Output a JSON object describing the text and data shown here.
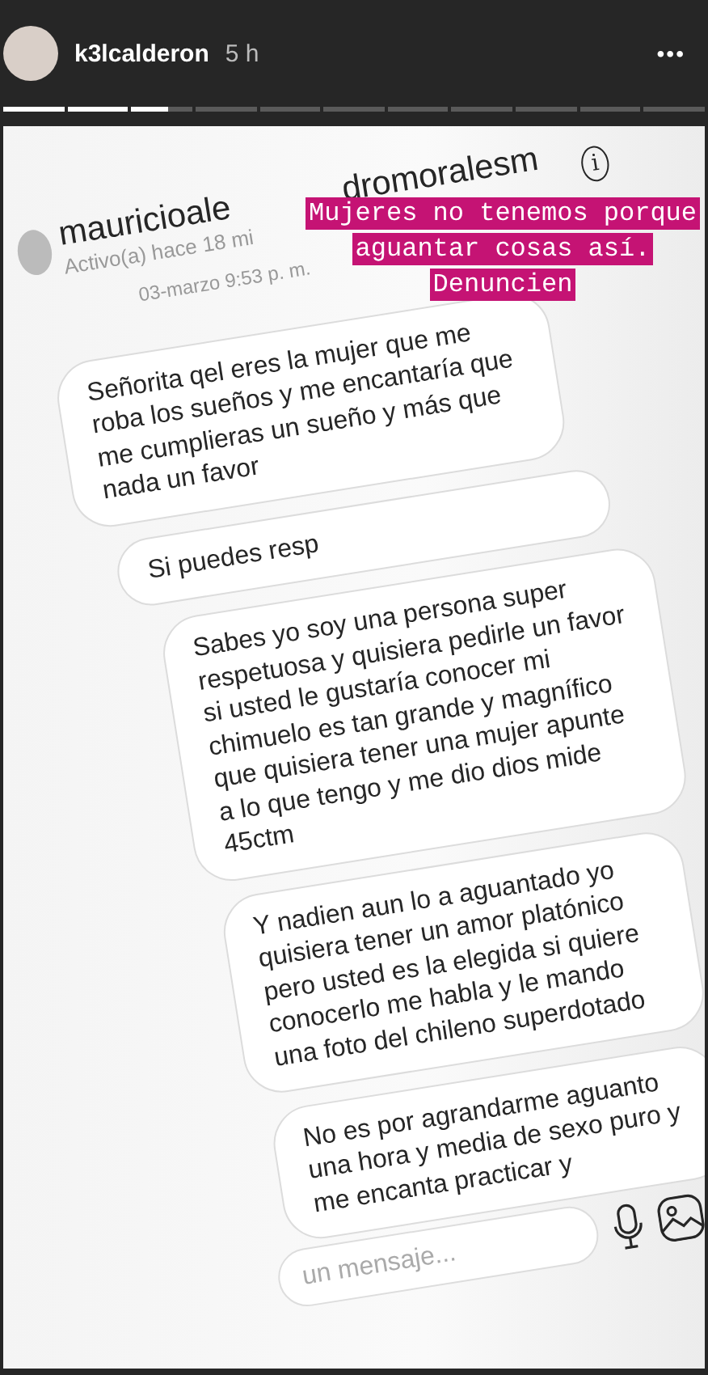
{
  "story_header": {
    "username": "k3lcalderon",
    "time": "5 h",
    "menu": "•••"
  },
  "progress_segments": [
    {
      "kind": "viewed"
    },
    {
      "kind": "viewed"
    },
    {
      "kind": "current",
      "level": 0.6
    },
    {
      "kind": "upcoming"
    },
    {
      "kind": "upcoming"
    },
    {
      "kind": "upcoming"
    },
    {
      "kind": "upcoming"
    },
    {
      "kind": "upcoming"
    },
    {
      "kind": "upcoming"
    },
    {
      "kind": "upcoming"
    },
    {
      "kind": "upcoming"
    }
  ],
  "caption_lines": [
    "Mujeres no tenemos porque",
    "aguantar cosas así.",
    "Denuncien"
  ],
  "chat": {
    "username_start": "mauricioale",
    "username_end": "dromoralesm",
    "status": "Activo(a) hace 18 mi",
    "info": "i",
    "date": "03-marzo 9:53 p. m.",
    "messages": [
      "Señorita qel eres la mujer que me roba los sueños y me encantaría que me cumplieras un sueño y más que nada un favor",
      "Si puedes resp",
      "Sabes yo soy una persona super respetuosa y quisiera pedirle un favor si usted le gustaría conocer mi chimuelo es tan grande y magnífico que quisiera tener una mujer apunte a lo que tengo y me dio dios mide 45ctm",
      "Y nadien aun lo a aguantado  yo quisiera tener un amor platónico pero usted es la elegida si quiere conocerlo me habla y le mando una foto del chileno superdotado",
      "No es por agrandarme aguanto una hora y media de sexo puro y me encanta practicar y"
    ],
    "placeholder": "un mensaje..."
  }
}
